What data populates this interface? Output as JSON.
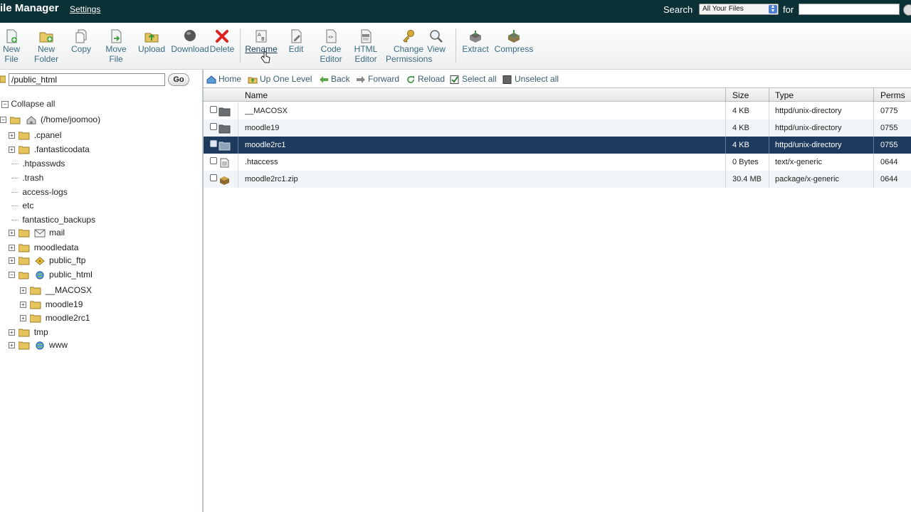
{
  "header": {
    "title": "ile Manager",
    "settings_link": "Settings",
    "search_label": "Search",
    "search_scope": "All Your Files",
    "for_label": "for",
    "search_value": ""
  },
  "toolbar": {
    "new_file": [
      "New",
      "File"
    ],
    "new_folder": [
      "New",
      "Folder"
    ],
    "copy": "Copy",
    "move_file": [
      "Move",
      "File"
    ],
    "upload": "Upload",
    "download": "Download",
    "delete": "Delete",
    "rename": "Rename",
    "edit": "Edit",
    "code_editor": [
      "Code",
      "Editor"
    ],
    "html_editor": [
      "HTML",
      "Editor"
    ],
    "change_permissions": [
      "Change",
      "Permissions"
    ],
    "view": "View",
    "extract": "Extract",
    "compress": "Compress"
  },
  "path": {
    "value": "/public_html",
    "go_label": "Go"
  },
  "tree": {
    "collapse_all": "Collapse all",
    "items": [
      {
        "label": "(/home/joomoo)"
      },
      {
        "label": ".cpanel"
      },
      {
        "label": ".fantasticodata"
      },
      {
        "label": ".htpasswds"
      },
      {
        "label": ".trash"
      },
      {
        "label": "access-logs"
      },
      {
        "label": "etc"
      },
      {
        "label": "fantastico_backups"
      },
      {
        "label": "mail"
      },
      {
        "label": "moodledata"
      },
      {
        "label": "public_ftp"
      },
      {
        "label": "public_html"
      },
      {
        "label": "__MACOSX"
      },
      {
        "label": "moodle19"
      },
      {
        "label": "moodle2rc1"
      },
      {
        "label": "tmp"
      },
      {
        "label": "www"
      }
    ]
  },
  "nav": {
    "home": "Home",
    "up_one_level": "Up One Level",
    "back": "Back",
    "forward": "Forward",
    "reload": "Reload",
    "select_all": "Select all",
    "unselect_all": "Unselect all"
  },
  "table": {
    "columns": [
      "Name",
      "Size",
      "Type",
      "Perms"
    ],
    "rows": [
      {
        "name": "__MACOSX",
        "size": "4 KB",
        "type": "httpd/unix-directory",
        "perms": "0775"
      },
      {
        "name": "moodle19",
        "size": "4 KB",
        "type": "httpd/unix-directory",
        "perms": "0755"
      },
      {
        "name": "moodle2rc1",
        "size": "4 KB",
        "type": "httpd/unix-directory",
        "perms": "0755"
      },
      {
        "name": ".htaccess",
        "size": "0 Bytes",
        "type": "text/x-generic",
        "perms": "0644"
      },
      {
        "name": "moodle2rc1.zip",
        "size": "30.4 MB",
        "type": "package/x-generic",
        "perms": "0644"
      }
    ]
  },
  "colors": {
    "header_bg": "#0b3036",
    "selected_row": "#1e3a5c",
    "toolbar_label": "#3c6b80"
  }
}
